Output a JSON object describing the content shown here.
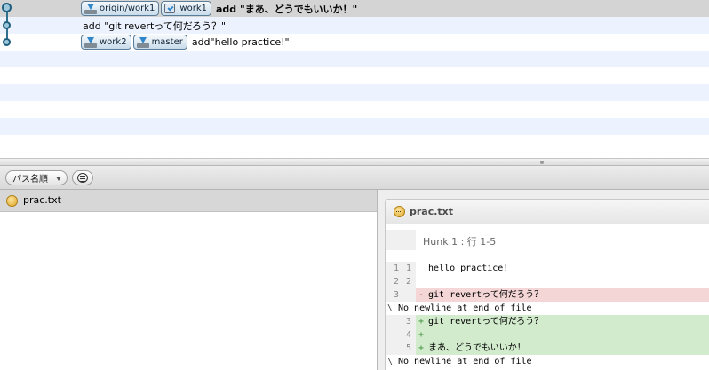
{
  "commits": [
    {
      "refs": [
        {
          "label": "origin/work1",
          "kind": "remote-branch-icon"
        },
        {
          "label": "work1",
          "kind": "current-branch-icon"
        }
      ],
      "message": "add \"まあ、どうでもいいか！\"",
      "selected": true
    },
    {
      "refs": [],
      "message": "add \"git revertって何だろう？\"",
      "selected": false
    },
    {
      "refs": [
        {
          "label": "work2",
          "kind": "local-branch-icon"
        },
        {
          "label": "master",
          "kind": "local-branch-icon"
        }
      ],
      "message": "add\"hello practice!\"",
      "selected": false
    }
  ],
  "toolbar": {
    "sort_label": "パス名順"
  },
  "files": [
    {
      "name": "prac.txt",
      "status": "modified"
    }
  ],
  "diff": {
    "file_name": "prac.txt",
    "hunk_header": "Hunk 1 : 行 1-5",
    "lines": [
      {
        "old": "1",
        "new": "1",
        "mark": "",
        "text": "hello practice!",
        "type": "context"
      },
      {
        "old": "2",
        "new": "2",
        "mark": "",
        "text": "",
        "type": "context"
      },
      {
        "old": "3",
        "new": "",
        "mark": "-",
        "text": "git revertって何だろう？",
        "type": "del"
      },
      {
        "old": "",
        "new": "",
        "mark": "\\",
        "text": "No newline at end of file",
        "type": "note"
      },
      {
        "old": "",
        "new": "3",
        "mark": "+",
        "text": "git revertって何だろう？",
        "type": "add"
      },
      {
        "old": "",
        "new": "4",
        "mark": "+",
        "text": "",
        "type": "add"
      },
      {
        "old": "",
        "new": "5",
        "mark": "+",
        "text": "まあ、どうでもいいか！",
        "type": "add"
      },
      {
        "old": "",
        "new": "",
        "mark": "\\",
        "text": "No newline at end of file",
        "type": "note"
      }
    ]
  },
  "colors": {
    "selected_row": "#d4d4d4",
    "stripe_row": "#edf3fe",
    "deleted_line": "#f4d6d6",
    "added_line": "#d2ebcd"
  }
}
